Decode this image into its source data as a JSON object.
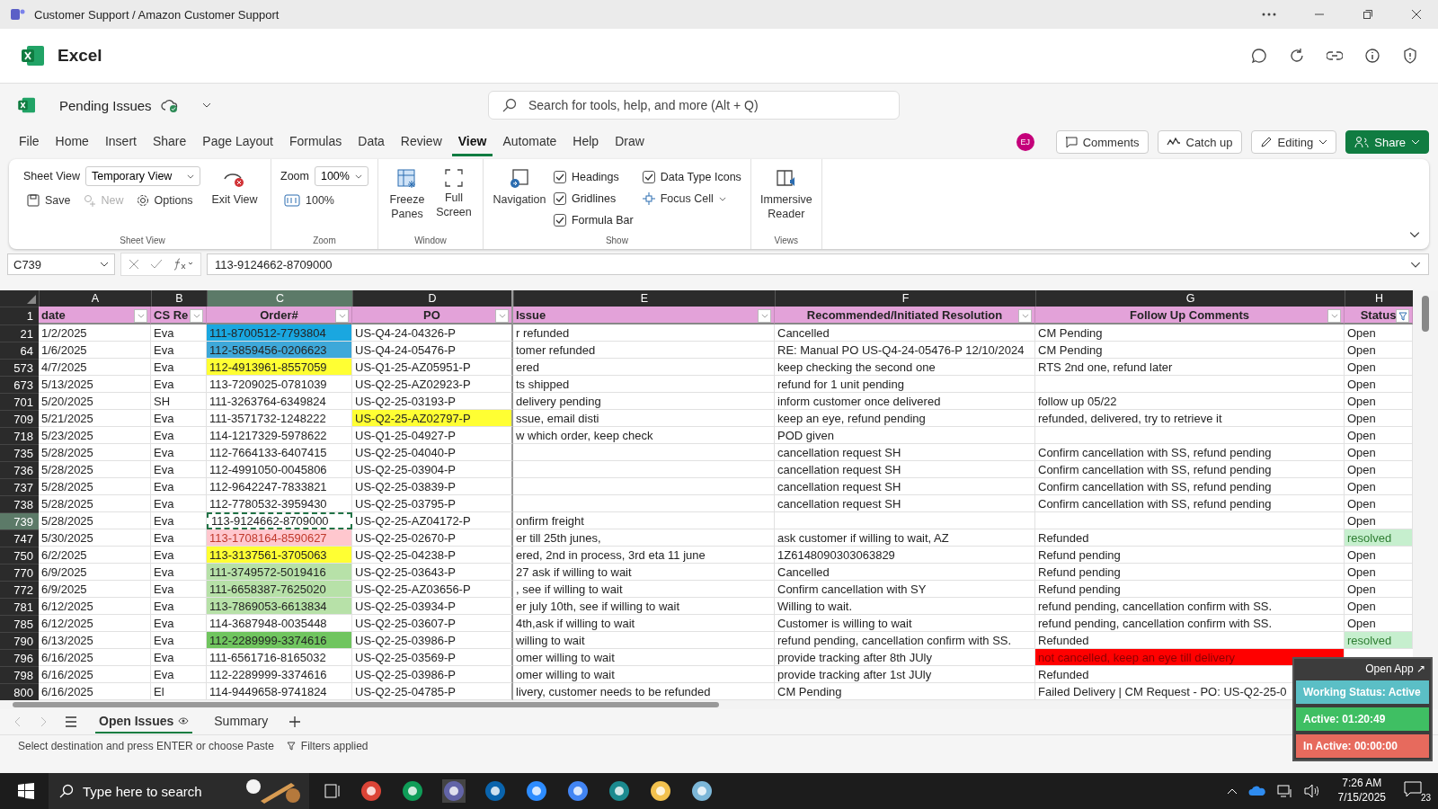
{
  "window": {
    "title": "Customer Support / Amazon Customer Support"
  },
  "app": {
    "name": "Excel"
  },
  "document": {
    "name": "Pending Issues",
    "search_placeholder": "Search for tools, help, and more (Alt + Q)"
  },
  "menu": [
    {
      "label": "File",
      "selected": false
    },
    {
      "label": "Home",
      "selected": false
    },
    {
      "label": "Insert",
      "selected": false
    },
    {
      "label": "Share",
      "selected": false
    },
    {
      "label": "Page Layout",
      "selected": false
    },
    {
      "label": "Formulas",
      "selected": false
    },
    {
      "label": "Data",
      "selected": false
    },
    {
      "label": "Review",
      "selected": false
    },
    {
      "label": "View",
      "selected": true
    },
    {
      "label": "Automate",
      "selected": false
    },
    {
      "label": "Help",
      "selected": false
    },
    {
      "label": "Draw",
      "selected": false
    }
  ],
  "user_initials": "EJ",
  "actions": [
    {
      "label": "Comments",
      "kind": "plain"
    },
    {
      "label": "Catch up",
      "kind": "plain"
    },
    {
      "label": "Editing",
      "kind": "dropdown"
    },
    {
      "label": "Share",
      "kind": "primary"
    }
  ],
  "ribbon": {
    "sheet_view": {
      "label": "Sheet View",
      "view": "Temporary View",
      "buttons": [
        {
          "label": "Save",
          "disabled": false
        },
        {
          "label": "New",
          "disabled": true
        },
        {
          "label": "Options",
          "disabled": false
        }
      ],
      "exit": "Exit View",
      "group": "Sheet View"
    },
    "zoom": {
      "label": "Zoom",
      "value": "100%",
      "reset": "100%",
      "group": "Zoom"
    },
    "window": {
      "freeze": "Freeze Panes",
      "full": "Full Screen",
      "group": "Window"
    },
    "show": {
      "navigation": "Navigation",
      "options": [
        {
          "label": "Headings",
          "checked": true
        },
        {
          "label": "Gridlines",
          "checked": true
        },
        {
          "label": "Formula Bar",
          "checked": true
        },
        {
          "label": "Data Type Icons",
          "checked": true
        }
      ],
      "focus_cell": "Focus Cell",
      "group": "Show"
    },
    "views": {
      "button": "Immersive Reader",
      "group": "Views"
    }
  },
  "formula_bar": {
    "name_box": "C739",
    "formula": "113-9124662-8709000"
  },
  "sheet": {
    "header_row": "1",
    "columns": [
      {
        "letter": "A",
        "header": "date",
        "selected": false,
        "filtered": false
      },
      {
        "letter": "B",
        "header": "CS Re",
        "selected": false,
        "filtered": false
      },
      {
        "letter": "C",
        "header": "Order#",
        "selected": true,
        "filtered": false
      },
      {
        "letter": "D",
        "header": "PO",
        "selected": false,
        "filtered": false
      },
      {
        "letter": "E",
        "header": "Issue",
        "selected": false,
        "filtered": false
      },
      {
        "letter": "F",
        "header": "Recommended/Initiated Resolution",
        "selected": false,
        "filtered": false
      },
      {
        "letter": "G",
        "header": "Follow Up Comments",
        "selected": false,
        "filtered": false
      },
      {
        "letter": "H",
        "header": "Status",
        "selected": false,
        "filtered": true
      }
    ],
    "rows": [
      {
        "row": "21",
        "selected": false,
        "cells": [
          {
            "text": "1/2/2025"
          },
          {
            "text": "Eva"
          },
          {
            "text": "111-8700512-7793804",
            "color": "#1aa7e0"
          },
          {
            "text": "US-Q4-24-04326-P"
          },
          {
            "text": "r refunded"
          },
          {
            "text": "Cancelled"
          },
          {
            "text": "CM Pending"
          },
          {
            "text": "Open"
          }
        ]
      },
      {
        "row": "64",
        "selected": false,
        "cells": [
          {
            "text": "1/6/2025"
          },
          {
            "text": "Eva"
          },
          {
            "text": "112-5859456-0206623",
            "color": "#3ea8d9"
          },
          {
            "text": "US-Q4-24-05476-P"
          },
          {
            "text": "tomer refunded"
          },
          {
            "text": "RE: Manual PO  US-Q4-24-05476-P  12/10/2024"
          },
          {
            "text": "CM Pending"
          },
          {
            "text": "Open"
          }
        ]
      },
      {
        "row": "573",
        "selected": false,
        "cells": [
          {
            "text": "4/7/2025"
          },
          {
            "text": "Eva"
          },
          {
            "text": "112-4913961-8557059",
            "color": "#ffff33"
          },
          {
            "text": "US-Q1-25-AZ05951-P"
          },
          {
            "text": "ered"
          },
          {
            "text": "keep checking the second one"
          },
          {
            "text": "RTS 2nd one, refund later"
          },
          {
            "text": "Open"
          }
        ]
      },
      {
        "row": "673",
        "selected": false,
        "cells": [
          {
            "text": "5/13/2025"
          },
          {
            "text": "Eva"
          },
          {
            "text": "113-7209025-0781039"
          },
          {
            "text": "US-Q2-25-AZ02923-P"
          },
          {
            "text": "ts shipped"
          },
          {
            "text": "refund for 1 unit pending"
          },
          {
            "text": ""
          },
          {
            "text": "Open"
          }
        ]
      },
      {
        "row": "701",
        "selected": false,
        "cells": [
          {
            "text": "5/20/2025"
          },
          {
            "text": "SH"
          },
          {
            "text": "111-3263764-6349824"
          },
          {
            "text": "US-Q2-25-03193-P"
          },
          {
            "text": "delivery pending"
          },
          {
            "text": "inform customer once delivered"
          },
          {
            "text": "follow up 05/22"
          },
          {
            "text": "Open"
          }
        ]
      },
      {
        "row": "709",
        "selected": false,
        "cells": [
          {
            "text": "5/21/2025"
          },
          {
            "text": "Eva"
          },
          {
            "text": "111-3571732-1248222"
          },
          {
            "text": "US-Q2-25-AZ02797-P",
            "color": "#ffff33"
          },
          {
            "text": "ssue, email disti"
          },
          {
            "text": "keep an eye, refund pending"
          },
          {
            "text": "refunded, delivered, try to retrieve it"
          },
          {
            "text": "Open"
          }
        ]
      },
      {
        "row": "718",
        "selected": false,
        "cells": [
          {
            "text": "5/23/2025"
          },
          {
            "text": "Eva"
          },
          {
            "text": "114-1217329-5978622"
          },
          {
            "text": "US-Q1-25-04927-P"
          },
          {
            "text": "w which order, keep check"
          },
          {
            "text": "POD given"
          },
          {
            "text": ""
          },
          {
            "text": "Open"
          }
        ]
      },
      {
        "row": "735",
        "selected": false,
        "cells": [
          {
            "text": "5/28/2025"
          },
          {
            "text": "Eva"
          },
          {
            "text": "112-7664133-6407415"
          },
          {
            "text": "US-Q2-25-04040-P"
          },
          {
            "text": ""
          },
          {
            "text": "cancellation request SH"
          },
          {
            "text": "Confirm cancellation with SS, refund pending"
          },
          {
            "text": "Open"
          }
        ]
      },
      {
        "row": "736",
        "selected": false,
        "cells": [
          {
            "text": "5/28/2025"
          },
          {
            "text": "Eva"
          },
          {
            "text": "112-4991050-0045806"
          },
          {
            "text": "US-Q2-25-03904-P"
          },
          {
            "text": ""
          },
          {
            "text": "cancellation request SH"
          },
          {
            "text": "Confirm cancellation with SS, refund pending"
          },
          {
            "text": "Open"
          }
        ]
      },
      {
        "row": "737",
        "selected": false,
        "cells": [
          {
            "text": "5/28/2025"
          },
          {
            "text": "Eva"
          },
          {
            "text": "112-9642247-7833821"
          },
          {
            "text": "US-Q2-25-03839-P"
          },
          {
            "text": ""
          },
          {
            "text": "cancellation request SH"
          },
          {
            "text": "Confirm cancellation with SS, refund pending"
          },
          {
            "text": "Open"
          }
        ]
      },
      {
        "row": "738",
        "selected": false,
        "cells": [
          {
            "text": "5/28/2025"
          },
          {
            "text": "Eva"
          },
          {
            "text": "112-7780532-3959430"
          },
          {
            "text": "US-Q2-25-03795-P"
          },
          {
            "text": ""
          },
          {
            "text": "cancellation request SH"
          },
          {
            "text": "Confirm cancellation with SS, refund pending"
          },
          {
            "text": "Open"
          }
        ]
      },
      {
        "row": "739",
        "selected": true,
        "cells": [
          {
            "text": "5/28/2025"
          },
          {
            "text": "Eva"
          },
          {
            "text": "113-9124662-8709000"
          },
          {
            "text": "US-Q2-25-AZ04172-P"
          },
          {
            "text": "onfirm freight"
          },
          {
            "text": ""
          },
          {
            "text": ""
          },
          {
            "text": "Open"
          }
        ]
      },
      {
        "row": "747",
        "selected": false,
        "cells": [
          {
            "text": "5/30/2025"
          },
          {
            "text": "Eva"
          },
          {
            "text": "113-1708164-8590627",
            "color": "#ffc7ce",
            "kind": "bad"
          },
          {
            "text": "US-Q2-25-02670-P"
          },
          {
            "text": "er till 25th junes,"
          },
          {
            "text": "ask customer if willing to wait, AZ"
          },
          {
            "text": "Refunded"
          },
          {
            "text": "resolved",
            "color": "#c6efce",
            "kind": "good"
          }
        ]
      },
      {
        "row": "750",
        "selected": false,
        "cells": [
          {
            "text": "6/2/2025"
          },
          {
            "text": "Eva"
          },
          {
            "text": "113-3137561-3705063",
            "color": "#ffff33"
          },
          {
            "text": "US-Q2-25-04238-P"
          },
          {
            "text": "ered, 2nd in process, 3rd eta 11 june"
          },
          {
            "text": "1Z6148090303063829"
          },
          {
            "text": "Refund pending"
          },
          {
            "text": "Open"
          }
        ]
      },
      {
        "row": "770",
        "selected": false,
        "cells": [
          {
            "text": "6/9/2025"
          },
          {
            "text": "Eva"
          },
          {
            "text": "111-3749572-5019416",
            "color": "#b7e1a8"
          },
          {
            "text": "US-Q2-25-03643-P"
          },
          {
            "text": "27 ask if willing to wait"
          },
          {
            "text": "Cancelled"
          },
          {
            "text": "Refund pending"
          },
          {
            "text": "Open"
          }
        ]
      },
      {
        "row": "772",
        "selected": false,
        "cells": [
          {
            "text": "6/9/2025"
          },
          {
            "text": "Eva"
          },
          {
            "text": "111-6658387-7625020",
            "color": "#b7e1a8"
          },
          {
            "text": "US-Q2-25-AZ03656-P"
          },
          {
            "text": ", see if willing to wait"
          },
          {
            "text": "Confirm cancellation with SY"
          },
          {
            "text": "Refund pending"
          },
          {
            "text": "Open"
          }
        ]
      },
      {
        "row": "781",
        "selected": false,
        "cells": [
          {
            "text": "6/12/2025"
          },
          {
            "text": "Eva"
          },
          {
            "text": "113-7869053-6613834",
            "color": "#b7e1a8"
          },
          {
            "text": "US-Q2-25-03934-P"
          },
          {
            "text": "er july 10th, see if willing to wait"
          },
          {
            "text": "Willing to wait."
          },
          {
            "text": "refund pending, cancellation confirm with SS."
          },
          {
            "text": "Open"
          }
        ]
      },
      {
        "row": "785",
        "selected": false,
        "cells": [
          {
            "text": "6/12/2025"
          },
          {
            "text": "Eva"
          },
          {
            "text": "114-3687948-0035448"
          },
          {
            "text": "US-Q2-25-03607-P"
          },
          {
            "text": "4th,ask if willing to wait"
          },
          {
            "text": "Customer is willing to wait"
          },
          {
            "text": "refund pending, cancellation confirm with SS."
          },
          {
            "text": "Open"
          }
        ]
      },
      {
        "row": "790",
        "selected": false,
        "cells": [
          {
            "text": "6/13/2025"
          },
          {
            "text": "Eva"
          },
          {
            "text": "112-2289999-3374616",
            "color": "#70c55f"
          },
          {
            "text": "US-Q2-25-03986-P"
          },
          {
            "text": "willing to wait"
          },
          {
            "text": "refund pending, cancellation confirm with SS."
          },
          {
            "text": "Refunded"
          },
          {
            "text": "resolved",
            "color": "#c6efce",
            "kind": "good"
          }
        ]
      },
      {
        "row": "796",
        "selected": false,
        "cells": [
          {
            "text": "6/16/2025"
          },
          {
            "text": "Eva"
          },
          {
            "text": "111-6561716-8165032"
          },
          {
            "text": "US-Q2-25-03569-P"
          },
          {
            "text": "omer willing to wait"
          },
          {
            "text": "provide tracking after 8th JUly"
          },
          {
            "text": "not cancelled, keep an eye till delivery",
            "color": "#ff0000",
            "kind": "alert"
          }
        ]
      },
      {
        "row": "798",
        "selected": false,
        "cells": [
          {
            "text": "6/16/2025"
          },
          {
            "text": "Eva"
          },
          {
            "text": "112-2289999-3374616"
          },
          {
            "text": "US-Q2-25-03986-P"
          },
          {
            "text": "omer willing to wait"
          },
          {
            "text": "provide tracking after 1st JUly"
          },
          {
            "text": "Refunded"
          }
        ]
      },
      {
        "row": "800",
        "selected": false,
        "cells": [
          {
            "text": "6/16/2025"
          },
          {
            "text": "El"
          },
          {
            "text": "114-9449658-9741824"
          },
          {
            "text": "US-Q2-25-04785-P"
          },
          {
            "text": "livery, customer needs to be refunded"
          },
          {
            "text": "CM Pending"
          },
          {
            "text": "Failed Delivery | CM Request - PO: US-Q2-25-0"
          }
        ]
      }
    ]
  },
  "sheet_tabs": [
    {
      "label": "Open Issues",
      "selected": true
    },
    {
      "label": "Summary",
      "selected": false
    }
  ],
  "status_bar": {
    "message": "Select destination and press ENTER or choose Paste",
    "filter": "Filters applied"
  },
  "tracker": {
    "open_app": "Open App ↗",
    "status": "Working Status: Active",
    "active": "Active: 01:20:49",
    "inactive": "In Active: 00:00:00"
  },
  "taskbar": {
    "search_placeholder": "Type here to search",
    "time": "7:26 AM",
    "date": "7/15/2025",
    "notifications": "23"
  }
}
